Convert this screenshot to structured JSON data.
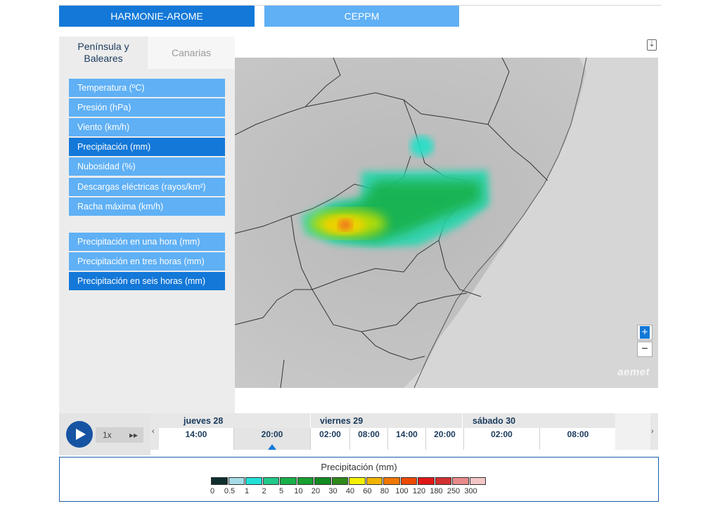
{
  "model_tabs": {
    "harmonie": "HARMONIE-AROME",
    "ceppm": "CEPPM"
  },
  "region_tabs": {
    "peninsula": "Península y Baleares",
    "canarias": "Canarias"
  },
  "variables": [
    {
      "label": "Temperatura (ºC)",
      "active": false
    },
    {
      "label": "Presión (hPa)",
      "active": false
    },
    {
      "label": "Viento (km/h)",
      "active": false
    },
    {
      "label": "Precipitación (mm)",
      "active": true
    },
    {
      "label": "Nubosidad (%)",
      "active": false
    },
    {
      "label": "Descargas eléctricas (rayos/km²)",
      "active": false
    },
    {
      "label": "Racha máxima (km/h)",
      "active": false
    }
  ],
  "precip_options": [
    {
      "label": "Precipitación en una hora (mm)",
      "active": false
    },
    {
      "label": "Precipitación en tres horas (mm)",
      "active": false
    },
    {
      "label": "Precipitación en seis horas (mm)",
      "active": true
    }
  ],
  "map": {
    "zoom_in": "+",
    "zoom_out": "−",
    "logo": "aemet",
    "download_icon": "⇣"
  },
  "player": {
    "speed": "1x",
    "fast_forward": "▸▸"
  },
  "timeline": {
    "prev": "‹",
    "next": "›",
    "days": [
      "jueves 28",
      "viernes 29",
      "sábado 30"
    ],
    "hours": [
      "14:00",
      "20:00",
      "02:00",
      "08:00",
      "14:00",
      "20:00",
      "02:00",
      "08:00"
    ],
    "selected_hour": "20:00"
  },
  "legend": {
    "title": "Precipitación (mm)",
    "labels": [
      "0",
      "0.5",
      "1",
      "2",
      "5",
      "10",
      "20",
      "30",
      "40",
      "60",
      "80",
      "100",
      "120",
      "180",
      "250",
      "300"
    ],
    "colors": [
      "#0f2e2e",
      "#a6dce6",
      "#22e0d8",
      "#22c98a",
      "#19b04a",
      "#18a030",
      "#128a22",
      "#2f8a1a",
      "#f4f000",
      "#f0b400",
      "#f07800",
      "#ec4a00",
      "#e01818",
      "#d23030",
      "#e88a8a",
      "#f4c6c6"
    ]
  }
}
